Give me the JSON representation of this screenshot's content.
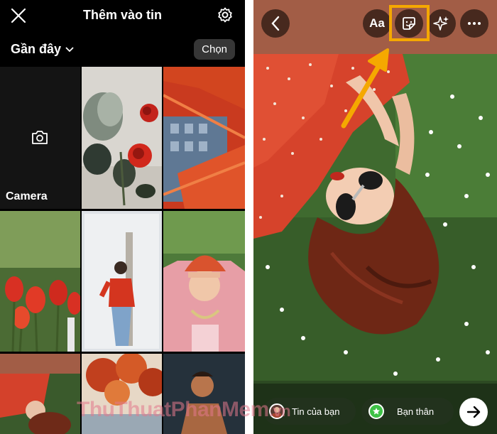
{
  "left": {
    "title": "Thêm vào tin",
    "recent_label": "Gần đây",
    "choose_label": "Chọn",
    "camera_label": "Camera",
    "icons": [
      "close-icon",
      "gear-icon",
      "chevron-down-icon",
      "camera-icon"
    ]
  },
  "right": {
    "text_tool_label": "Aa",
    "icons": [
      "chevron-left-icon",
      "sticker-icon",
      "sparkles-icon",
      "more-icon",
      "arrow-right-icon",
      "star-icon"
    ],
    "pill_story_label": "Tin của bạn",
    "pill_friends_label": "Bạn thân",
    "highlight_color": "#f5a800"
  },
  "watermark": {
    "main": "ThuThuatPhanMem",
    "suffix": ".vn"
  }
}
